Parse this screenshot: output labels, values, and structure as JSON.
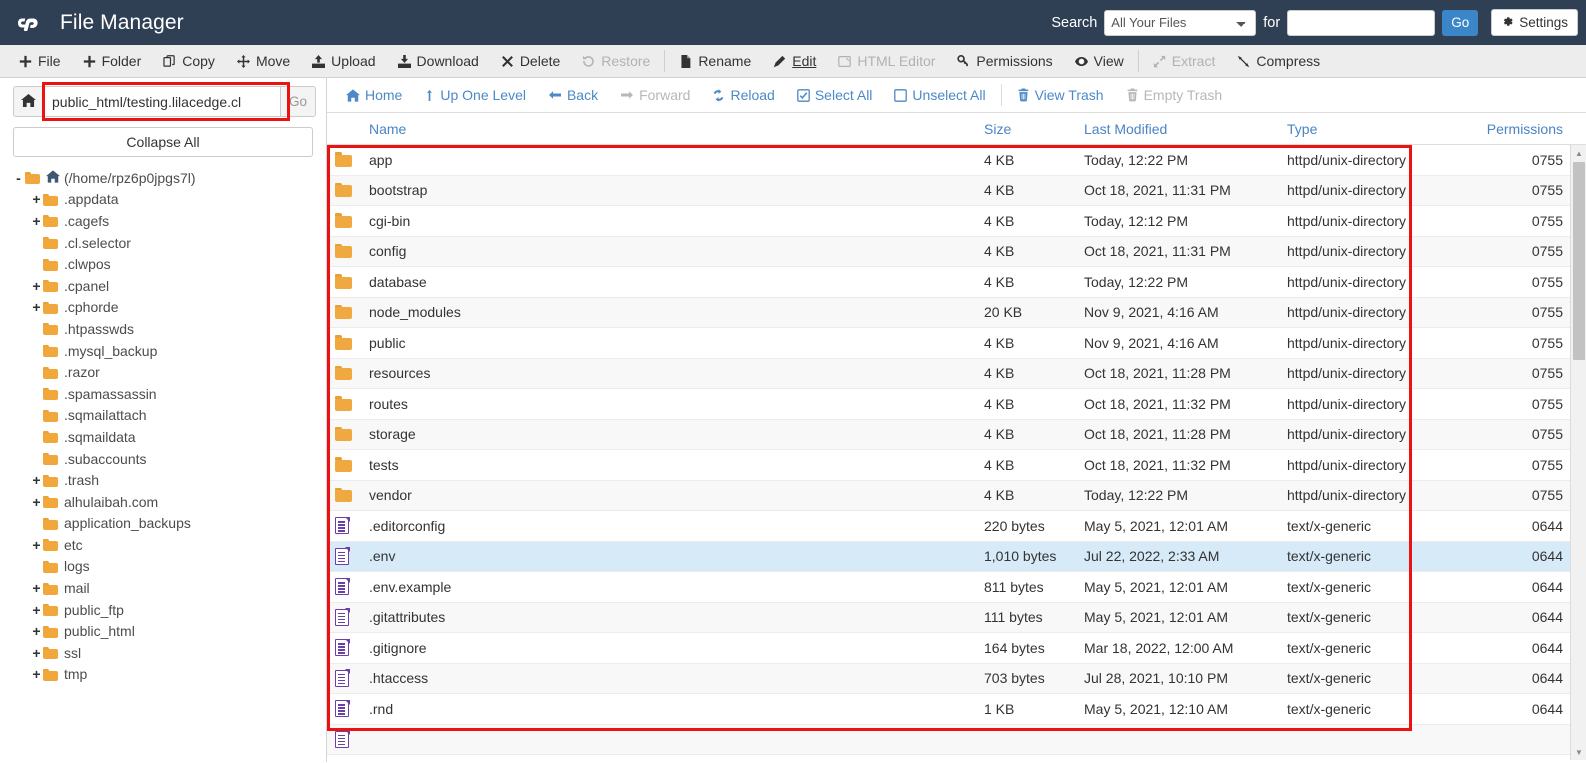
{
  "header": {
    "brand_title": "File Manager",
    "logo_icon": "cpanel-logo-icon",
    "search_label": "Search",
    "search_scope_selected": "All Your Files",
    "search_scope_options": [
      "All Your Files"
    ],
    "search_for_label": "for",
    "search_value": "",
    "search_placeholder": "",
    "go_label": "Go",
    "settings_label": "Settings",
    "settings_icon": "gear-icon",
    "bg_color": "#2f4054",
    "go_color": "#3b86c8"
  },
  "toolbar": {
    "items": [
      {
        "label": "File",
        "icon": "plus-icon",
        "state": "enabled"
      },
      {
        "label": "Folder",
        "icon": "plus-icon",
        "state": "enabled"
      },
      {
        "label": "Copy",
        "icon": "copy-icon",
        "state": "enabled"
      },
      {
        "label": "Move",
        "icon": "move-arrows-icon",
        "state": "enabled"
      },
      {
        "label": "Upload",
        "icon": "upload-icon",
        "state": "enabled"
      },
      {
        "label": "Download",
        "icon": "download-icon",
        "state": "enabled"
      },
      {
        "label": "Delete",
        "icon": "x-icon",
        "state": "enabled"
      },
      {
        "label": "Restore",
        "icon": "undo-icon",
        "state": "disabled"
      },
      {
        "label": "Rename",
        "icon": "document-icon",
        "state": "enabled"
      },
      {
        "label": "Edit",
        "icon": "pencil-icon",
        "state": "active"
      },
      {
        "label": "HTML Editor",
        "icon": "html-editor-icon",
        "state": "disabled"
      },
      {
        "label": "Permissions",
        "icon": "key-icon",
        "state": "enabled"
      },
      {
        "label": "View",
        "icon": "eye-icon",
        "state": "enabled"
      },
      {
        "label": "Extract",
        "icon": "extract-icon",
        "state": "disabled"
      },
      {
        "label": "Compress",
        "icon": "compress-icon",
        "state": "enabled"
      }
    ]
  },
  "sidebar": {
    "home_icon": "home-icon",
    "path_value": "public_html/testing.lilacedge.cl",
    "go_label": "Go",
    "collapse_all_label": "Collapse All",
    "tree": [
      {
        "label": "(/home/rpz6p0jpgs7l)",
        "depth": 0,
        "toggle": "-",
        "icon": "open-folder-home-icon"
      },
      {
        "label": ".appdata",
        "depth": 1,
        "toggle": "+",
        "icon": "folder-icon"
      },
      {
        "label": ".cagefs",
        "depth": 1,
        "toggle": "+",
        "icon": "folder-icon"
      },
      {
        "label": ".cl.selector",
        "depth": 1,
        "toggle": "",
        "icon": "folder-icon"
      },
      {
        "label": ".clwpos",
        "depth": 1,
        "toggle": "",
        "icon": "folder-icon"
      },
      {
        "label": ".cpanel",
        "depth": 1,
        "toggle": "+",
        "icon": "folder-icon"
      },
      {
        "label": ".cphorde",
        "depth": 1,
        "toggle": "+",
        "icon": "folder-icon"
      },
      {
        "label": ".htpasswds",
        "depth": 1,
        "toggle": "",
        "icon": "folder-icon"
      },
      {
        "label": ".mysql_backup",
        "depth": 1,
        "toggle": "",
        "icon": "folder-icon"
      },
      {
        "label": ".razor",
        "depth": 1,
        "toggle": "",
        "icon": "folder-icon"
      },
      {
        "label": ".spamassassin",
        "depth": 1,
        "toggle": "",
        "icon": "folder-icon"
      },
      {
        "label": ".sqmailattach",
        "depth": 1,
        "toggle": "",
        "icon": "folder-icon"
      },
      {
        "label": ".sqmaildata",
        "depth": 1,
        "toggle": "",
        "icon": "folder-icon"
      },
      {
        "label": ".subaccounts",
        "depth": 1,
        "toggle": "",
        "icon": "folder-icon"
      },
      {
        "label": ".trash",
        "depth": 1,
        "toggle": "+",
        "icon": "folder-icon"
      },
      {
        "label": "alhulaibah.com",
        "depth": 1,
        "toggle": "+",
        "icon": "folder-icon"
      },
      {
        "label": "application_backups",
        "depth": 1,
        "toggle": "",
        "icon": "folder-icon"
      },
      {
        "label": "etc",
        "depth": 1,
        "toggle": "+",
        "icon": "folder-icon"
      },
      {
        "label": "logs",
        "depth": 1,
        "toggle": "",
        "icon": "folder-icon"
      },
      {
        "label": "mail",
        "depth": 1,
        "toggle": "+",
        "icon": "folder-icon"
      },
      {
        "label": "public_ftp",
        "depth": 1,
        "toggle": "+",
        "icon": "folder-icon"
      },
      {
        "label": "public_html",
        "depth": 1,
        "toggle": "+",
        "icon": "folder-icon"
      },
      {
        "label": "ssl",
        "depth": 1,
        "toggle": "+",
        "icon": "folder-icon"
      },
      {
        "label": "tmp",
        "depth": 1,
        "toggle": "+",
        "icon": "folder-icon"
      }
    ]
  },
  "nav": {
    "items": [
      {
        "label": "Home",
        "icon": "home-icon",
        "state": "enabled"
      },
      {
        "label": "Up One Level",
        "icon": "up-arrow-icon",
        "state": "enabled"
      },
      {
        "label": "Back",
        "icon": "left-arrow-icon",
        "state": "enabled"
      },
      {
        "label": "Forward",
        "icon": "right-arrow-icon",
        "state": "disabled"
      },
      {
        "label": "Reload",
        "icon": "reload-icon",
        "state": "enabled"
      },
      {
        "label": "Select All",
        "icon": "checked-box-icon",
        "state": "enabled"
      },
      {
        "label": "Unselect All",
        "icon": "empty-box-icon",
        "state": "enabled"
      },
      {
        "label": "View Trash",
        "icon": "trash-icon",
        "state": "enabled"
      },
      {
        "label": "Empty Trash",
        "icon": "trash-icon",
        "state": "disabled"
      }
    ]
  },
  "table": {
    "columns": [
      "Name",
      "Size",
      "Last Modified",
      "Type",
      "Permissions"
    ],
    "rows": [
      {
        "name": "app",
        "size": "4 KB",
        "modified": "Today, 12:22 PM",
        "type": "httpd/unix-directory",
        "permissions": "0755",
        "icon": "folder-icon",
        "selected": false
      },
      {
        "name": "bootstrap",
        "size": "4 KB",
        "modified": "Oct 18, 2021, 11:31 PM",
        "type": "httpd/unix-directory",
        "permissions": "0755",
        "icon": "folder-icon",
        "selected": false
      },
      {
        "name": "cgi-bin",
        "size": "4 KB",
        "modified": "Today, 12:12 PM",
        "type": "httpd/unix-directory",
        "permissions": "0755",
        "icon": "folder-icon",
        "selected": false
      },
      {
        "name": "config",
        "size": "4 KB",
        "modified": "Oct 18, 2021, 11:31 PM",
        "type": "httpd/unix-directory",
        "permissions": "0755",
        "icon": "folder-icon",
        "selected": false
      },
      {
        "name": "database",
        "size": "4 KB",
        "modified": "Today, 12:22 PM",
        "type": "httpd/unix-directory",
        "permissions": "0755",
        "icon": "folder-icon",
        "selected": false
      },
      {
        "name": "node_modules",
        "size": "20 KB",
        "modified": "Nov 9, 2021, 4:16 AM",
        "type": "httpd/unix-directory",
        "permissions": "0755",
        "icon": "folder-icon",
        "selected": false
      },
      {
        "name": "public",
        "size": "4 KB",
        "modified": "Nov 9, 2021, 4:16 AM",
        "type": "httpd/unix-directory",
        "permissions": "0755",
        "icon": "folder-icon",
        "selected": false
      },
      {
        "name": "resources",
        "size": "4 KB",
        "modified": "Oct 18, 2021, 11:28 PM",
        "type": "httpd/unix-directory",
        "permissions": "0755",
        "icon": "folder-icon",
        "selected": false
      },
      {
        "name": "routes",
        "size": "4 KB",
        "modified": "Oct 18, 2021, 11:32 PM",
        "type": "httpd/unix-directory",
        "permissions": "0755",
        "icon": "folder-icon",
        "selected": false
      },
      {
        "name": "storage",
        "size": "4 KB",
        "modified": "Oct 18, 2021, 11:28 PM",
        "type": "httpd/unix-directory",
        "permissions": "0755",
        "icon": "folder-icon",
        "selected": false
      },
      {
        "name": "tests",
        "size": "4 KB",
        "modified": "Oct 18, 2021, 11:32 PM",
        "type": "httpd/unix-directory",
        "permissions": "0755",
        "icon": "folder-icon",
        "selected": false
      },
      {
        "name": "vendor",
        "size": "4 KB",
        "modified": "Today, 12:22 PM",
        "type": "httpd/unix-directory",
        "permissions": "0755",
        "icon": "folder-icon",
        "selected": false
      },
      {
        "name": ".editorconfig",
        "size": "220 bytes",
        "modified": "May 5, 2021, 12:01 AM",
        "type": "text/x-generic",
        "permissions": "0644",
        "icon": "text-file-icon",
        "selected": false
      },
      {
        "name": ".env",
        "size": "1,010 bytes",
        "modified": "Jul 22, 2022, 2:33 AM",
        "type": "text/x-generic",
        "permissions": "0644",
        "icon": "text-file-icon",
        "selected": true
      },
      {
        "name": ".env.example",
        "size": "811 bytes",
        "modified": "May 5, 2021, 12:01 AM",
        "type": "text/x-generic",
        "permissions": "0644",
        "icon": "text-file-icon",
        "selected": false
      },
      {
        "name": ".gitattributes",
        "size": "111 bytes",
        "modified": "May 5, 2021, 12:01 AM",
        "type": "text/x-generic",
        "permissions": "0644",
        "icon": "text-file-icon",
        "selected": false
      },
      {
        "name": ".gitignore",
        "size": "164 bytes",
        "modified": "Mar 18, 2022, 12:00 AM",
        "type": "text/x-generic",
        "permissions": "0644",
        "icon": "text-file-icon",
        "selected": false
      },
      {
        "name": ".htaccess",
        "size": "703 bytes",
        "modified": "Jul 28, 2021, 10:10 PM",
        "type": "text/x-generic",
        "permissions": "0644",
        "icon": "text-file-icon",
        "selected": false
      },
      {
        "name": ".rnd",
        "size": "1 KB",
        "modified": "May 5, 2021, 12:10 AM",
        "type": "text/x-generic",
        "permissions": "0644",
        "icon": "text-file-icon",
        "selected": false
      },
      {
        "name": "",
        "size": "",
        "modified": "",
        "type": "",
        "permissions": "",
        "icon": "text-file-icon",
        "selected": false
      }
    ]
  },
  "annotations": {
    "highlight_color": "#ee1111",
    "boxes": [
      "path-input-highlight",
      "file-list-highlight"
    ]
  }
}
